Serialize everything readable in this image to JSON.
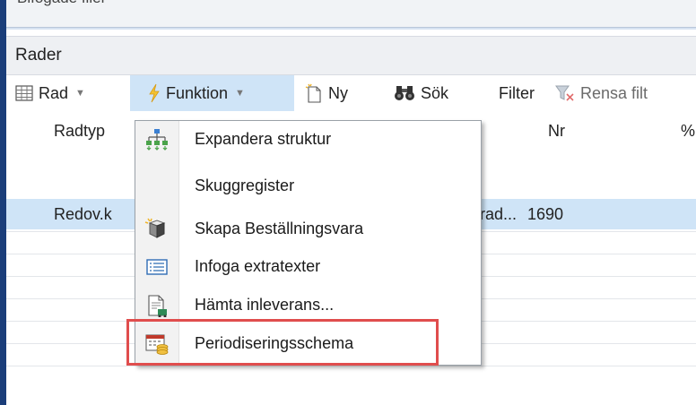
{
  "top_strip": {
    "title": "Bifogade filer"
  },
  "section": {
    "title": "Rader"
  },
  "toolbar": {
    "rad_label": "Rad",
    "funktion_label": "Funktion",
    "ny_label": "Ny",
    "sok_label": "Sök",
    "filter_label": "Filter",
    "rensa_label": "Rensa filt"
  },
  "table": {
    "headers": [
      "Radtyp",
      "Nr",
      "%"
    ],
    "rows": [
      {
        "radtyp": "Redov.k",
        "mid": "rad...",
        "nr": "1690"
      }
    ]
  },
  "menu": {
    "items": [
      {
        "label": "Expandera struktur",
        "icon": "structure-icon"
      },
      {
        "label": "Skuggregister",
        "icon": ""
      },
      {
        "label": "Skapa Beställningsvara",
        "icon": "order-item-icon"
      },
      {
        "label": "Infoga extratexter",
        "icon": "text-lines-icon"
      },
      {
        "label": "Hämta inleverans...",
        "icon": "delivery-icon"
      },
      {
        "label": "Periodiseringsschema",
        "icon": "calendar-coins-icon"
      }
    ]
  },
  "colors": {
    "accent": "#cfe4f7",
    "highlight_border": "#e04d4d",
    "frame": "#1b3e7a"
  }
}
